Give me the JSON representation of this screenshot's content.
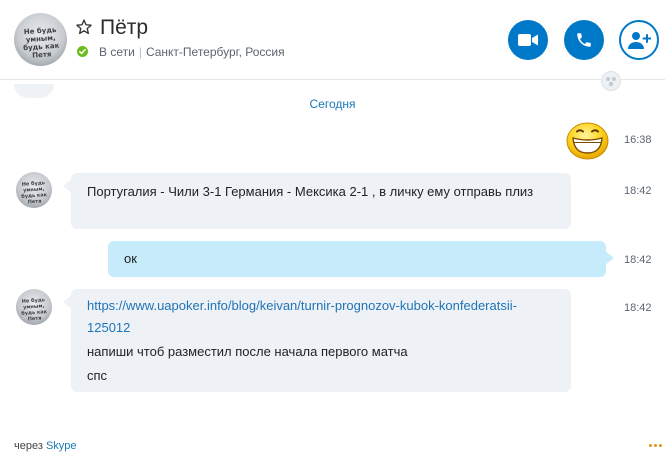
{
  "header": {
    "contact_name": "Пётр",
    "status": "В сети",
    "location": "Санкт-Петербург, Россия",
    "avatar_shirt_text": "Не будь умным, будь как Петя"
  },
  "chat": {
    "date_separator": "Сегодня",
    "messages": [
      {
        "direction": "out",
        "type": "emoji",
        "emoji": "grinning-emoji",
        "time": "16:38"
      },
      {
        "direction": "in",
        "type": "text",
        "text": "Португалия - Чили  3-1   Германия - Мексика 2-1  , в личку ему отправь плиз",
        "time": "18:42"
      },
      {
        "direction": "out",
        "type": "text",
        "text": "ок",
        "time": "18:42"
      },
      {
        "direction": "in",
        "type": "text",
        "link": "https://www.uapoker.info/blog/keivan/turnir-prognozov-kubok-konfederatsii-125012",
        "lines": [
          "напиши чтоб разместил после начала первого матча",
          "спс"
        ],
        "time": "18:42"
      }
    ]
  },
  "footer": {
    "via": "через",
    "app": "Skype"
  },
  "colors": {
    "accent": "#0078c8",
    "online": "#6cbb1f",
    "incoming_bubble": "#eef2f6",
    "outgoing_bubble": "#c6ebfa",
    "more": "#e3931d"
  }
}
